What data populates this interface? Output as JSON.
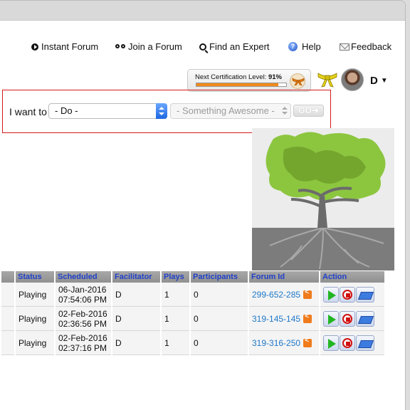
{
  "nav": {
    "instant_forum": "Instant Forum",
    "join_forum": "Join a Forum",
    "find_expert": "Find an Expert",
    "help": "Help",
    "feedback": "Feedback"
  },
  "cert": {
    "label": "Next Certification Level:",
    "percent_text": "91%",
    "progress": 0.91
  },
  "user": {
    "initial": "D"
  },
  "want": {
    "label": "I want to",
    "action_select": "- Do -",
    "object_select": "- Something Awesome -",
    "go_label": "GO"
  },
  "table": {
    "columns": [
      "Status",
      "Scheduled",
      "Facilitator",
      "Plays",
      "Participants",
      "Forum Id",
      "Action"
    ],
    "rows": [
      {
        "status": "Playing",
        "date": "06-Jan-2016",
        "time": "07:54:06 PM",
        "facilitator": "D",
        "plays": "1",
        "participants": "0",
        "forum_id": "299-652-285"
      },
      {
        "status": "Playing",
        "date": "02-Feb-2016",
        "time": "02:36:56 PM",
        "facilitator": "D",
        "plays": "1",
        "participants": "0",
        "forum_id": "319-145-145"
      },
      {
        "status": "Playing",
        "date": "02-Feb-2016",
        "time": "02:37:16 PM",
        "facilitator": "D",
        "plays": "1",
        "participants": "0",
        "forum_id": "319-316-250"
      }
    ]
  },
  "colors": {
    "accent_orange": "#f08a1c",
    "link_blue": "#1f78c8",
    "header_blue": "#2040c8",
    "highlight_red": "#d31a1a",
    "tree_green": "#8cc63f"
  },
  "icons": [
    "circle-arrow-icon",
    "binoculars-icon",
    "search-icon",
    "help-icon",
    "mail-icon",
    "belt-icon",
    "share-icon",
    "play-icon",
    "stop-icon",
    "money-icon"
  ]
}
